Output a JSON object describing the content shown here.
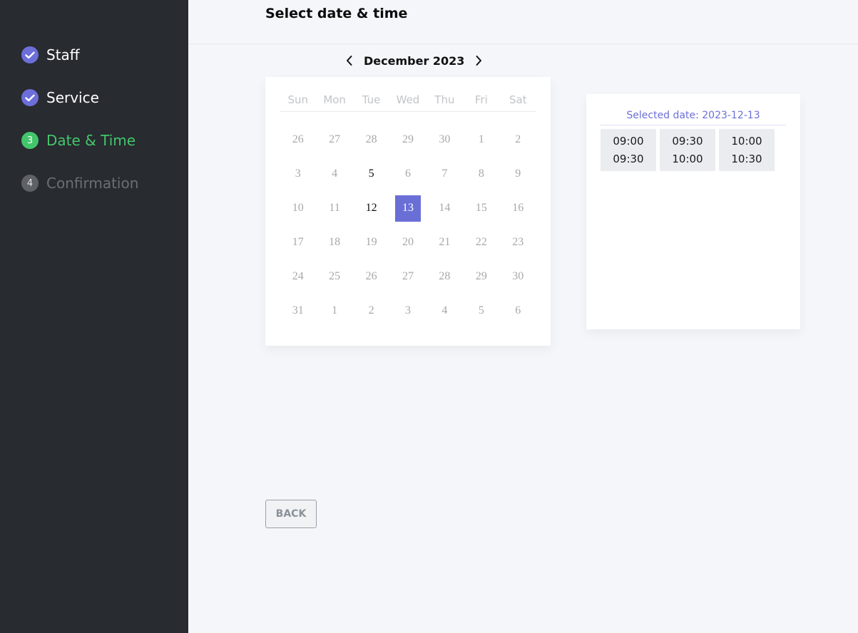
{
  "sidebar": {
    "steps": [
      {
        "badge": "✓",
        "label": "Staff"
      },
      {
        "badge": "✓",
        "label": "Service"
      },
      {
        "badge": "3",
        "label": "Date & Time"
      },
      {
        "badge": "4",
        "label": "Confirmation"
      }
    ]
  },
  "main": {
    "title": "Select date & time",
    "month_label": "December 2023",
    "prev_icon": "chevron-left-icon",
    "next_icon": "chevron-right-icon",
    "weekdays": [
      "Sun",
      "Mon",
      "Tue",
      "Wed",
      "Thu",
      "Fri",
      "Sat"
    ],
    "weeks": [
      [
        "26",
        "27",
        "28",
        "29",
        "30",
        "1",
        "2"
      ],
      [
        "3",
        "4",
        "5",
        "6",
        "7",
        "8",
        "9"
      ],
      [
        "10",
        "11",
        "12",
        "13",
        "14",
        "15",
        "16"
      ],
      [
        "17",
        "18",
        "19",
        "20",
        "21",
        "22",
        "23"
      ],
      [
        "24",
        "25",
        "26",
        "27",
        "28",
        "29",
        "30"
      ],
      [
        "31",
        "1",
        "2",
        "3",
        "4",
        "5",
        "6"
      ]
    ],
    "available_days": [
      "5",
      "12"
    ],
    "selected_day": "13",
    "selected_date_text": "Selected date: 2023-12-13",
    "slots": [
      {
        "start": "09:00",
        "end": "09:30"
      },
      {
        "start": "09:30",
        "end": "10:00"
      },
      {
        "start": "10:00",
        "end": "10:30"
      }
    ],
    "back_label": "BACK"
  },
  "colors": {
    "accent": "#6c6fd8",
    "active_step": "#43c66b",
    "sidebar_bg": "#282b30"
  }
}
